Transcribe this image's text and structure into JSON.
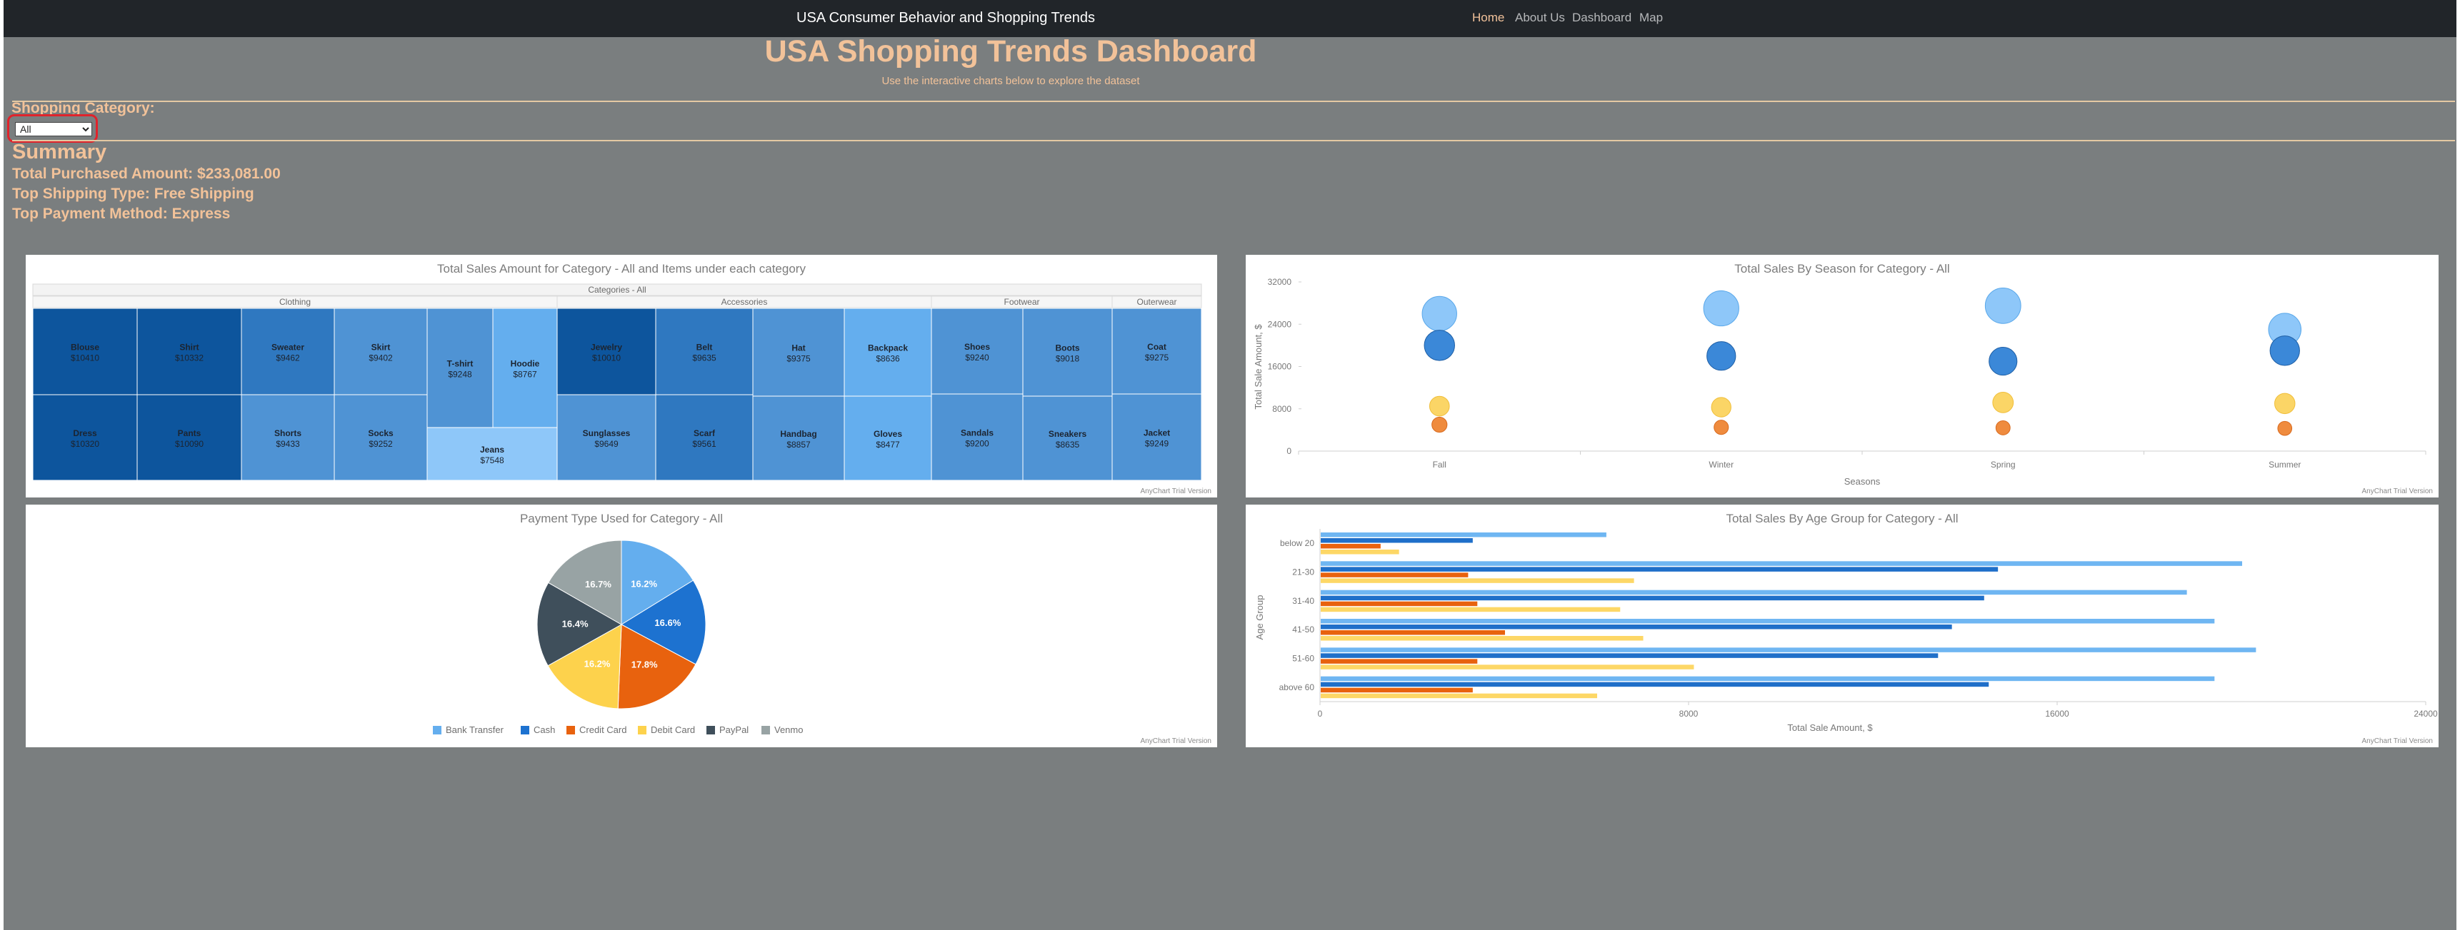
{
  "navbar": {
    "brand": "USA Consumer Behavior and Shopping Trends",
    "links": [
      "Home",
      "About Us",
      "Dashboard",
      "Map"
    ]
  },
  "header": {
    "title": "USA Shopping Trends Dashboard",
    "subtitle": "Use the interactive charts below to explore the dataset"
  },
  "filter": {
    "label": "Shopping Category:",
    "selected": "All",
    "options": [
      "All"
    ]
  },
  "summary": {
    "heading": "Summary",
    "total": "Total Purchased Amount: $233,081.00",
    "shipping": "Top Shipping Type: Free Shipping",
    "payment": "Top Payment Method: Express"
  },
  "credit_text": "AnyChart Trial Version",
  "colors": {
    "dark_blue": "#0d559d",
    "mid_blue": "#2f78c0",
    "blue": "#4f93d4",
    "light_blue": "#64aeee",
    "pale_blue": "#8ec7f9",
    "orange": "#e8620e",
    "yellow": "#fdd24c",
    "slate": "#3f4f5b",
    "gray": "#98a3a4"
  },
  "chart_data": [
    {
      "type": "treemap",
      "title": "Total Sales Amount for Category - All and Items under each category",
      "root": "Categories - All",
      "groups": [
        {
          "name": "Clothing",
          "items": [
            {
              "name": "Blouse",
              "value": 10410
            },
            {
              "name": "Shirt",
              "value": 10332
            },
            {
              "name": "Sweater",
              "value": 9462
            },
            {
              "name": "Skirt",
              "value": 9402
            },
            {
              "name": "T-shirt",
              "value": 9248
            },
            {
              "name": "Hoodie",
              "value": 8767
            },
            {
              "name": "Dress",
              "value": 10320
            },
            {
              "name": "Pants",
              "value": 10090
            },
            {
              "name": "Shorts",
              "value": 9433
            },
            {
              "name": "Socks",
              "value": 9252
            },
            {
              "name": "Jeans",
              "value": 7548
            }
          ]
        },
        {
          "name": "Accessories",
          "items": [
            {
              "name": "Jewelry",
              "value": 10010
            },
            {
              "name": "Belt",
              "value": 9635
            },
            {
              "name": "Hat",
              "value": 9375
            },
            {
              "name": "Backpack",
              "value": 8636
            },
            {
              "name": "Sunglasses",
              "value": 9649
            },
            {
              "name": "Scarf",
              "value": 9561
            },
            {
              "name": "Handbag",
              "value": 8857
            },
            {
              "name": "Gloves",
              "value": 8477
            }
          ]
        },
        {
          "name": "Footwear",
          "items": [
            {
              "name": "Shoes",
              "value": 9240
            },
            {
              "name": "Boots",
              "value": 9018
            },
            {
              "name": "Sandals",
              "value": 9200
            },
            {
              "name": "Sneakers",
              "value": 8635
            }
          ]
        },
        {
          "name": "Outerwear",
          "items": [
            {
              "name": "Coat",
              "value": 9275
            },
            {
              "name": "Jacket",
              "value": 9249
            }
          ]
        }
      ]
    },
    {
      "type": "scatter",
      "title": "Total Sales By Season for Category - All",
      "xlabel": "Seasons",
      "ylabel": "Total Sale Amount, $",
      "categories": [
        "Fall",
        "Winter",
        "Spring",
        "Summer"
      ],
      "ylim": [
        0,
        32000
      ],
      "yticks": [
        0,
        8000,
        16000,
        24000,
        32000
      ],
      "series": [
        {
          "values": [
            26000,
            27000,
            27500,
            23000
          ]
        },
        {
          "values": [
            20000,
            18000,
            17000,
            19000
          ]
        },
        {
          "values": [
            8500,
            8300,
            9200,
            9000
          ]
        },
        {
          "values": [
            5000,
            4500,
            4400,
            4300
          ]
        }
      ]
    },
    {
      "type": "pie",
      "title": "Payment Type Used for Category - All",
      "slices": [
        {
          "name": "Bank Transfer",
          "value": 16.2,
          "label": "16.2%"
        },
        {
          "name": "Cash",
          "value": 16.6,
          "label": "16.6%"
        },
        {
          "name": "Credit Card",
          "value": 17.8,
          "label": "17.8%"
        },
        {
          "name": "Debit Card",
          "value": 16.2,
          "label": "16.2%"
        },
        {
          "name": "PayPal",
          "value": 16.4,
          "label": "16.4%"
        },
        {
          "name": "Venmo",
          "value": 16.7,
          "label": "16.7%"
        }
      ]
    },
    {
      "type": "bar",
      "title": "Total Sales By Age Group for Category - All",
      "xlabel": "Total Sale Amount, $",
      "ylabel": "Age Group",
      "categories": [
        "below 20",
        "21-30",
        "31-40",
        "41-50",
        "51-60",
        "above 60"
      ],
      "xlim": [
        0,
        24000
      ],
      "xticks": [
        0,
        8000,
        16000,
        24000
      ],
      "series": [
        {
          "values": [
            6200,
            20000,
            18800,
            19400,
            20300,
            19400
          ]
        },
        {
          "values": [
            3300,
            14700,
            14400,
            13700,
            13400,
            14500
          ]
        },
        {
          "values": [
            1300,
            3200,
            3400,
            4000,
            3400,
            3300
          ]
        },
        {
          "values": [
            1700,
            6800,
            6500,
            7000,
            8100,
            6000
          ]
        }
      ]
    }
  ]
}
